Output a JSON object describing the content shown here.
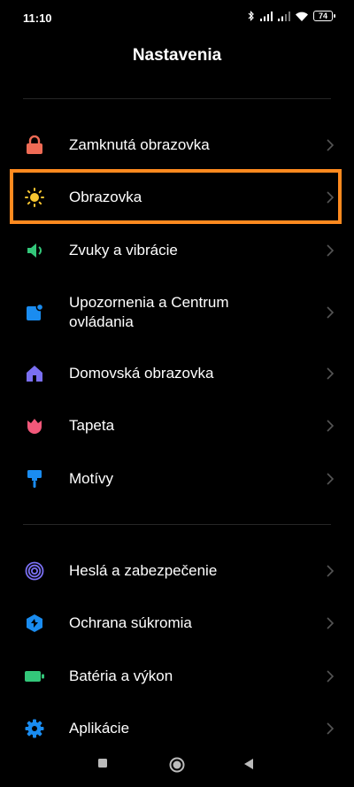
{
  "status": {
    "time": "11:10",
    "battery": "74"
  },
  "header": {
    "title": "Nastavenia"
  },
  "colors": {
    "highlight": "#ff8a1f",
    "background": "#000000"
  },
  "items": [
    {
      "label": "Zamknutá obrazovka",
      "icon": "lock-icon",
      "color": "#ef6b55"
    },
    {
      "label": "Obrazovka",
      "icon": "sun-icon",
      "color": "#f7c531"
    },
    {
      "label": "Zvuky a vibrácie",
      "icon": "speaker-icon",
      "color": "#33c77a"
    },
    {
      "label": "Upozornenia a Centrum ovládania",
      "icon": "notification-icon",
      "color": "#1a8cf0"
    },
    {
      "label": "Domovská obrazovka",
      "icon": "home-icon",
      "color": "#7a6ff2"
    },
    {
      "label": "Tapeta",
      "icon": "tulip-icon",
      "color": "#f2587a"
    },
    {
      "label": "Motívy",
      "icon": "brush-icon",
      "color": "#1a8cf0"
    },
    {
      "label": "Heslá a zabezpečenie",
      "icon": "fingerprint-icon",
      "color": "#7a6ff2"
    },
    {
      "label": "Ochrana súkromia",
      "icon": "privacy-shield-icon",
      "color": "#1a8cf0"
    },
    {
      "label": "Batéria a výkon",
      "icon": "battery-icon",
      "color": "#33c77a"
    },
    {
      "label": "Aplikácie",
      "icon": "gear-icon",
      "color": "#1a8cf0"
    }
  ]
}
